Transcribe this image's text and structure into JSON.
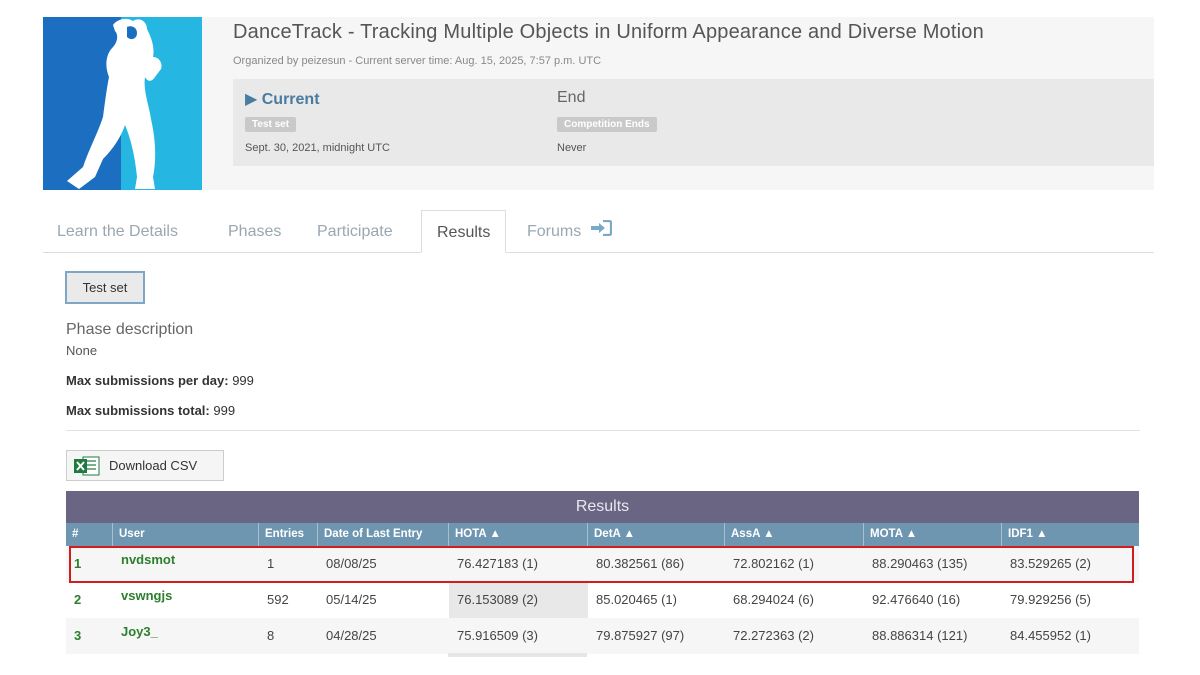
{
  "competition": {
    "title": "DanceTrack - Tracking Multiple Objects in Uniform Appearance and Diverse Motion",
    "subtitle": "Organized by peizesun - Current server time: Aug. 15, 2025, 7:57 p.m. UTC"
  },
  "phases": [
    {
      "name": "▶ Current",
      "tag": "Test set",
      "date": "Sept. 30, 2021, midnight UTC"
    },
    {
      "name": "End",
      "tag": "Competition Ends",
      "date": "Never"
    }
  ],
  "tabs": [
    {
      "label": "Learn the Details"
    },
    {
      "label": "Phases"
    },
    {
      "label": "Participate"
    },
    {
      "label": "Results"
    },
    {
      "label": "Forums"
    }
  ],
  "phase_button": "Test set",
  "phase_description": {
    "title": "Phase description",
    "value": "None"
  },
  "limits": [
    {
      "label": "Max submissions per day:",
      "value": "999"
    },
    {
      "label": "Max submissions total:",
      "value": "999"
    }
  ],
  "download_label": "Download CSV",
  "results": {
    "title": "Results",
    "columns": [
      "#",
      "User",
      "Entries",
      "Date of Last Entry",
      "HOTA ▲",
      "DetA ▲",
      "AssA ▲",
      "MOTA ▲",
      "IDF1 ▲"
    ],
    "rows": [
      {
        "rank": "1",
        "user": "nvdsmot",
        "entries": "1",
        "date": "08/08/25",
        "hota": "76.427183 (1)",
        "deta": "80.382561 (86)",
        "assa": "72.802162 (1)",
        "mota": "88.290463 (135)",
        "idf1": "83.529265 (2)"
      },
      {
        "rank": "2",
        "user": "vswngjs",
        "entries": "592",
        "date": "05/14/25",
        "hota": "76.153089 (2)",
        "deta": "85.020465 (1)",
        "assa": "68.294024 (6)",
        "mota": "92.476640 (16)",
        "idf1": "79.929256 (5)"
      },
      {
        "rank": "3",
        "user": "Joy3_",
        "entries": "8",
        "date": "04/28/25",
        "hota": "75.916509 (3)",
        "deta": "79.875927 (97)",
        "assa": "72.272363 (2)",
        "mota": "88.886314 (121)",
        "idf1": "84.455952 (1)"
      }
    ]
  },
  "colors": {
    "logo_blue": "#1c6fc0",
    "logo_cyan": "#25b6e2",
    "current_phase": "#4a7ba0",
    "results_header": "#696582",
    "column_header": "#6f96b1",
    "user_green": "#2c7f2c",
    "highlight_border": "#d21d1d"
  },
  "icons": {
    "logo": "dancer-silhouette-logo",
    "forums": "sign-in-arrow-icon",
    "csv": "excel-icon"
  }
}
